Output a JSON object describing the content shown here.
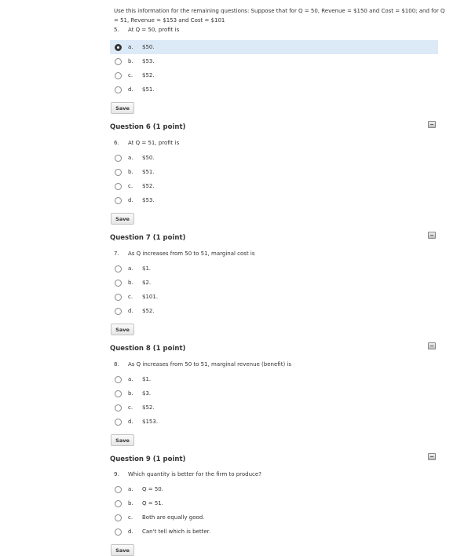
{
  "intro_text": "Use this information for the remaining questions: Suppose that for Q = 50, Revenue = $150 and Cost = $100; and for Q = 51, Revenue = $153 and Cost = $101",
  "questions": [
    {
      "title": "",
      "number": "5.",
      "prompt": "At Q = 50, profit is",
      "save_label": "Save",
      "options": [
        {
          "letter": "a.",
          "text": "$50.",
          "selected": true
        },
        {
          "letter": "b.",
          "text": "$53."
        },
        {
          "letter": "c.",
          "text": "$52."
        },
        {
          "letter": "d.",
          "text": "$51."
        }
      ]
    },
    {
      "title": "Question 6 (1 point)",
      "number": "6.",
      "prompt": "At Q = 51, profit is",
      "save_label": "Save",
      "options": [
        {
          "letter": "a.",
          "text": "$50."
        },
        {
          "letter": "b.",
          "text": "$51."
        },
        {
          "letter": "c.",
          "text": "$52."
        },
        {
          "letter": "d.",
          "text": "$53."
        }
      ]
    },
    {
      "title": "Question 7 (1 point)",
      "number": "7.",
      "prompt": "As Q increases from 50 to 51, marginal cost is",
      "save_label": "Save",
      "options": [
        {
          "letter": "a.",
          "text": "$1."
        },
        {
          "letter": "b.",
          "text": "$2."
        },
        {
          "letter": "c.",
          "text": "$101."
        },
        {
          "letter": "d.",
          "text": "$52."
        }
      ]
    },
    {
      "title": "Question 8 (1 point)",
      "number": "8.",
      "prompt": "As Q increases from 50 to 51, marginal revenue (benefit) is",
      "save_label": "Save",
      "options": [
        {
          "letter": "a.",
          "text": "$1."
        },
        {
          "letter": "b.",
          "text": "$3."
        },
        {
          "letter": "c.",
          "text": "$52."
        },
        {
          "letter": "d.",
          "text": "$153."
        }
      ]
    },
    {
      "title": "Question 9 (1 point)",
      "number": "9.",
      "prompt": "Which quantity is better for the firm to produce?",
      "save_label": "Save",
      "options": [
        {
          "letter": "a.",
          "text": "Q = 50."
        },
        {
          "letter": "b.",
          "text": "Q = 51."
        },
        {
          "letter": "c.",
          "text": "Both are equally good."
        },
        {
          "letter": "d.",
          "text": "Can't tell which is better."
        }
      ]
    }
  ]
}
